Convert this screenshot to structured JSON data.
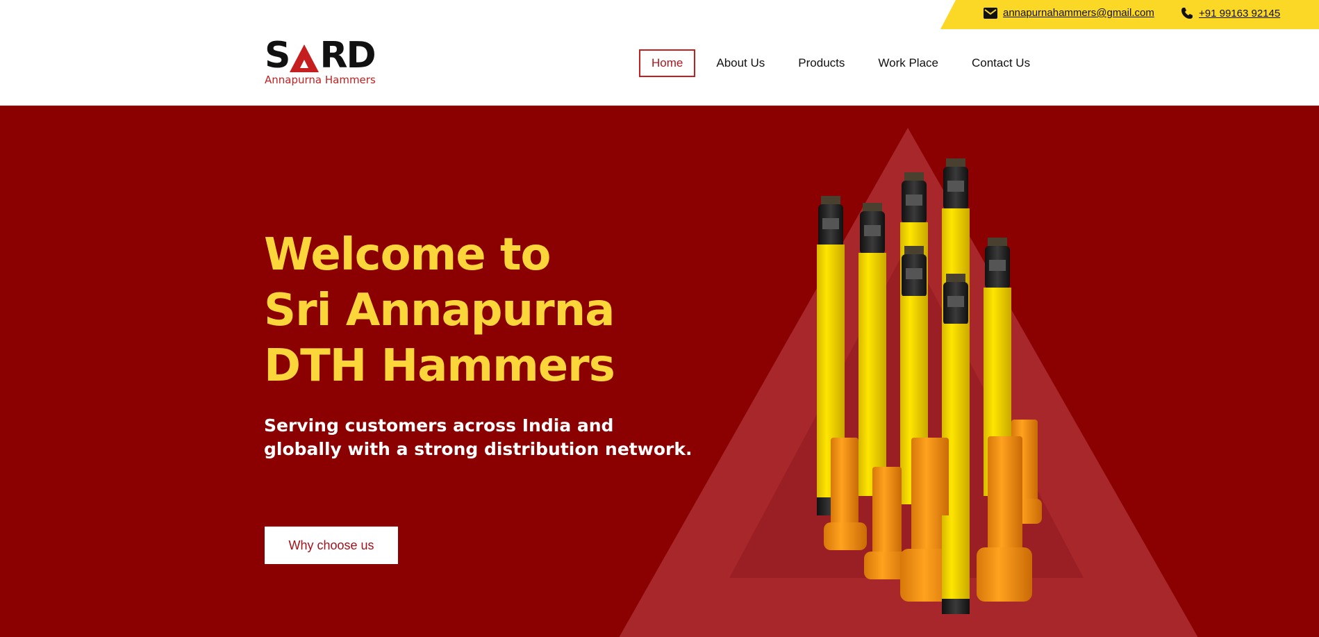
{
  "topbar": {
    "email": "annapurnahammers@gmail.com",
    "phone": "+91 99163 92145",
    "email_icon": "mail-icon",
    "phone_icon": "phone-icon"
  },
  "logo": {
    "wordmark_left": "S",
    "wordmark_right": "RD",
    "tagline": "Annapurna Hammers"
  },
  "nav": {
    "items": [
      "Home",
      "About Us",
      "Products",
      "Work Place",
      "Contact Us"
    ],
    "active": "Home"
  },
  "hero": {
    "title_lines": [
      "Welcome to",
      "Sri Annapurna",
      "DTH Hammers"
    ],
    "subtitle": "Serving customers across India and globally with a strong distribution network.",
    "cta_label": "Why choose us",
    "image": "dth-hammers-product-image"
  },
  "colors": {
    "accent_yellow": "#fcd826",
    "hero_red": "#8b0000",
    "brand_red": "#c41e1e",
    "title_yellow": "#fbd63a"
  }
}
